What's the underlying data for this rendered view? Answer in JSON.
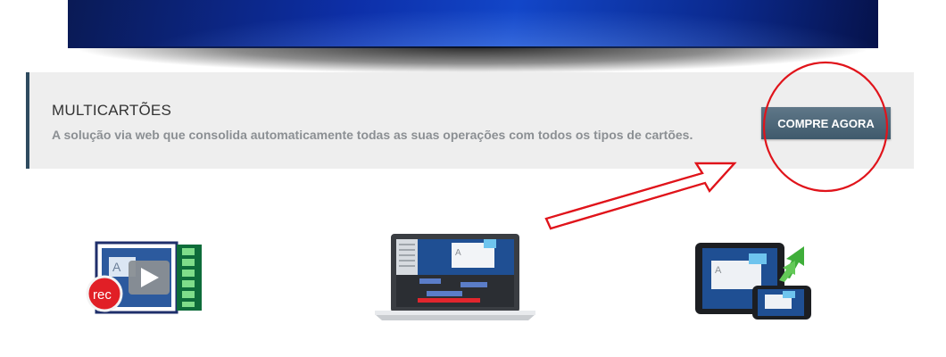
{
  "callout": {
    "title": "MULTICARTÕES",
    "subtitle": "A solução via web que consolida automaticamente todas as suas operações com todos os tipos de cartões.",
    "button_label": "COMPRE AGORA"
  },
  "features": {
    "record_icon": {
      "icon": "video-record-icon",
      "badge": "rec"
    },
    "laptop_icon": {
      "icon": "laptop-editor-icon",
      "glyph": "A"
    },
    "devices_icon": {
      "icon": "tablet-phone-share-icon",
      "glyph": "A"
    }
  },
  "colors": {
    "accent_bar": "#2e4b5f",
    "button": "#4b6677",
    "annotation": "#e0141b",
    "callout_bg": "#eeeeee"
  }
}
